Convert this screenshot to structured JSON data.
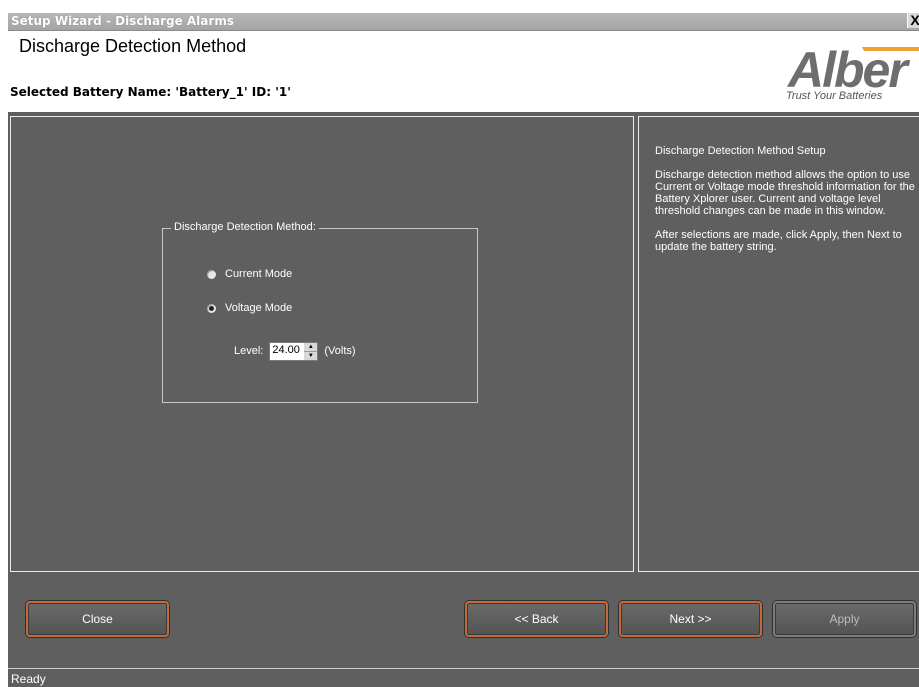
{
  "window": {
    "title": "Setup Wizard - Discharge Alarms",
    "close_glyph": "X"
  },
  "header": {
    "page_title": "Discharge Detection Method",
    "battery_line": "Selected Battery Name: 'Battery_1' ID: '1'",
    "logo_text": "Alber",
    "logo_tagline": "Trust Your Batteries"
  },
  "group": {
    "label": "Discharge Detection Method:",
    "options": [
      {
        "label": "Current Mode",
        "selected": false
      },
      {
        "label": "Voltage Mode",
        "selected": true
      }
    ],
    "level_label": "Level:",
    "level_value": "24.00",
    "level_unit": "(Volts)"
  },
  "help": {
    "heading": "Discharge Detection Method Setup",
    "paragraph1": "Discharge detection method allows the option to use Current or Voltage mode threshold information for the Battery Xplorer user. Current and voltage level threshold changes can be made in this window.",
    "paragraph2": "After selections are made, click Apply, then Next to update the battery string."
  },
  "buttons": {
    "close": "Close",
    "back": "<< Back",
    "next": "Next >>",
    "apply": "Apply"
  },
  "status": {
    "text": "Ready"
  },
  "colors": {
    "panel_bg": "#5f5f5f",
    "button_accent": "#c46a3a",
    "logo_gray": "#6e6e6e",
    "logo_orange": "#f0a030"
  }
}
